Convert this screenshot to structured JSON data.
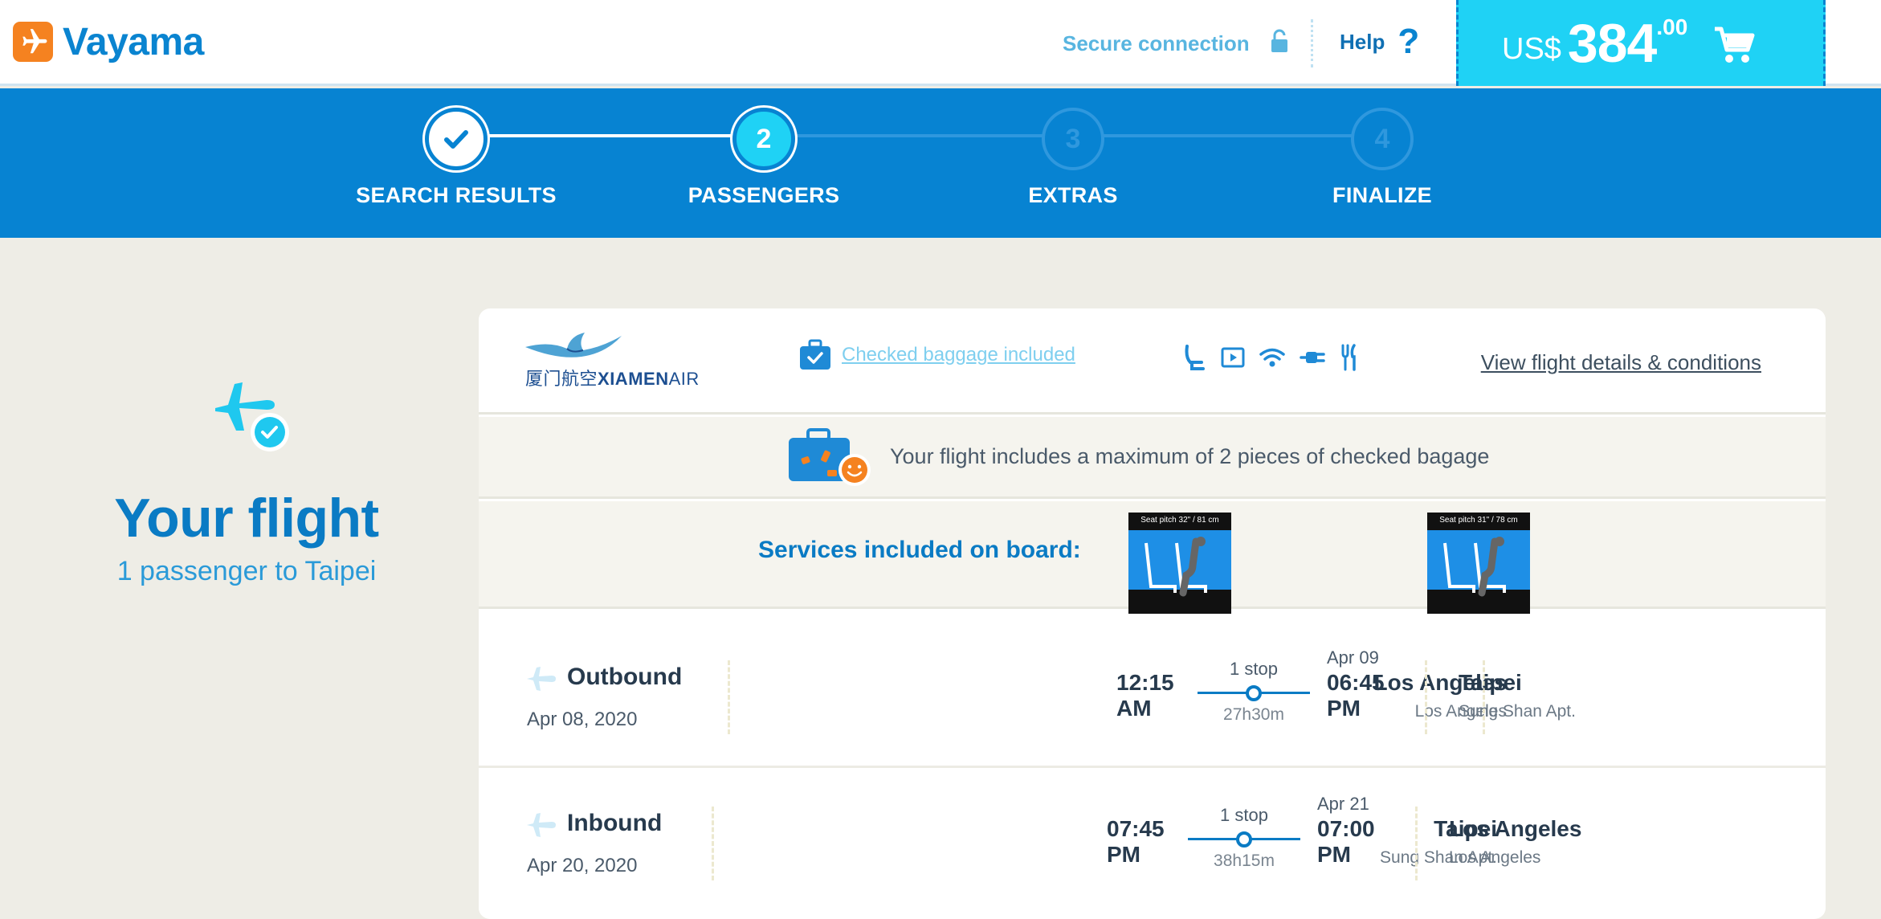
{
  "header": {
    "brand": "Vayama",
    "secure_label": "Secure connection",
    "help_label": "Help",
    "help_icon": "?",
    "cart": {
      "currency": "US$",
      "amount": "384",
      "cents": ".00"
    }
  },
  "stepper": {
    "steps": [
      {
        "number": "",
        "label": "SEARCH RESULTS",
        "state": "done"
      },
      {
        "number": "2",
        "label": "PASSENGERS",
        "state": "current"
      },
      {
        "number": "3",
        "label": "EXTRAS",
        "state": "upcoming"
      },
      {
        "number": "4",
        "label": "FINALIZE",
        "state": "upcoming"
      }
    ]
  },
  "summary": {
    "title": "Your flight",
    "subtitle": "1 passenger to Taipei"
  },
  "flight": {
    "airline_cn": "厦门航空",
    "airline_en_bold": "XIAMEN",
    "airline_en_light": "AIR",
    "baggage_link": "Checked baggage included",
    "amenities": [
      "seat-icon",
      "video-icon",
      "wifi-icon",
      "power-icon",
      "meal-icon"
    ],
    "details_link": "View flight details & conditions",
    "baggage_note": "Your flight includes a maximum of 2 pieces of checked bagage",
    "services_label": "Services included on board:",
    "seats": [
      {
        "caption": "Seat pitch 32\" / 81 cm"
      },
      {
        "caption": "Seat pitch 31\" / 78 cm"
      }
    ],
    "outbound": {
      "direction": "Outbound",
      "date": "Apr 08, 2020",
      "from_city": "Los Angeles",
      "from_airport": "Los Angeles",
      "dep_time_1": "12:15",
      "dep_time_2": "AM",
      "stops": "1 stop",
      "duration": "27h30m",
      "arr_date": "Apr 09",
      "arr_time_1": "06:45",
      "arr_time_2": "PM",
      "to_city": "Taipei",
      "to_airport": "Sung Shan Apt."
    },
    "inbound": {
      "direction": "Inbound",
      "date": "Apr 20, 2020",
      "from_city": "Taipei",
      "from_airport": "Sung Shan Apt.",
      "dep_time_1": "07:45",
      "dep_time_2": "PM",
      "stops": "1 stop",
      "duration": "38h15m",
      "arr_date": "Apr 21",
      "arr_time_1": "07:00",
      "arr_time_2": "PM",
      "to_city": "Los Angeles",
      "to_airport": "Los Angeles"
    }
  },
  "colors": {
    "brand_blue": "#0783d2",
    "accent_cyan": "#1fd2f5",
    "logo_orange": "#f58220",
    "page_bg": "#eeede6"
  }
}
